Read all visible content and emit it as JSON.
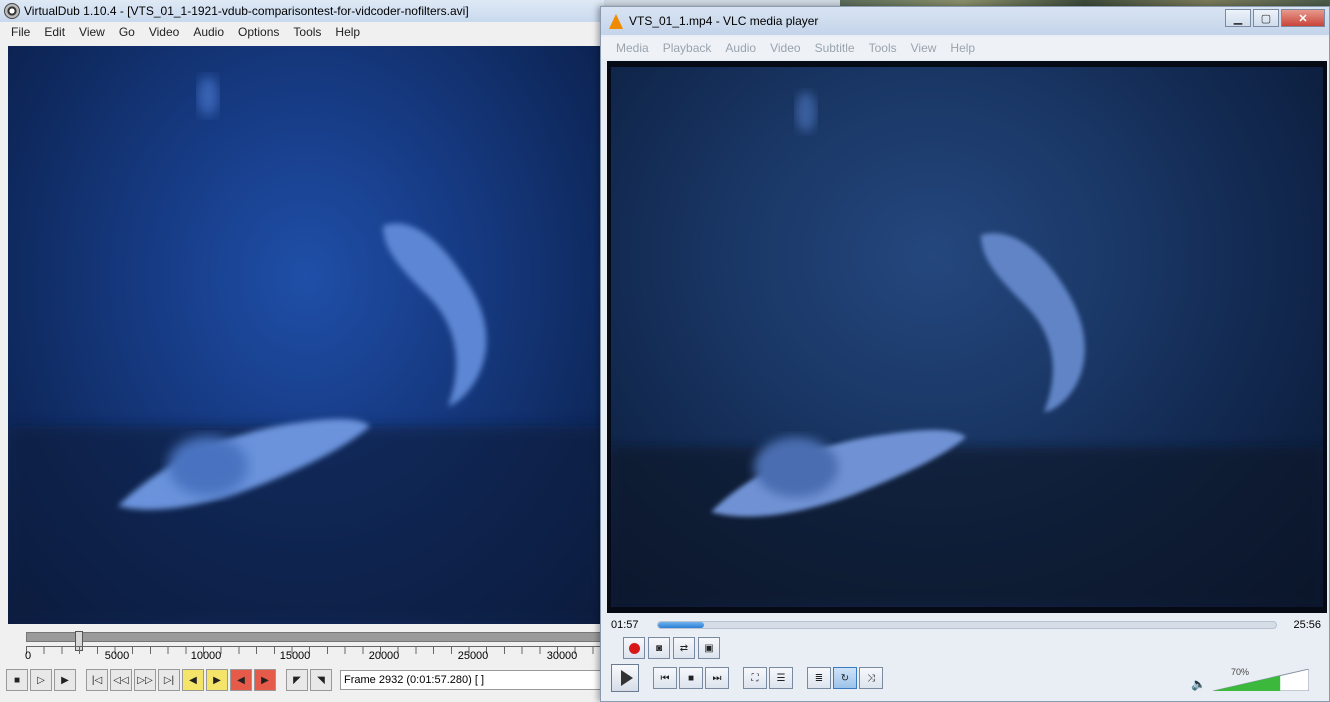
{
  "virtualdub": {
    "title": "VirtualDub 1.10.4 - [VTS_01_1-1921-vdub-comparisontest-for-vidcoder-nofilters.avi]",
    "menu": [
      "File",
      "Edit",
      "View",
      "Go",
      "Video",
      "Audio",
      "Options",
      "Tools",
      "Help"
    ],
    "timeline": {
      "ticks": [
        "0",
        "5000",
        "10000",
        "15000",
        "20000",
        "25000",
        "30000"
      ],
      "position_fraction": 0.089
    },
    "frame_status": "Frame 2932 (0:01:57.280) [ ]"
  },
  "vlc": {
    "title": "VTS_01_1.mp4 - VLC media player",
    "menu": [
      "Media",
      "Playback",
      "Audio",
      "Video",
      "Subtitle",
      "Tools",
      "View",
      "Help"
    ],
    "elapsed": "01:57",
    "duration": "25:56",
    "progress_fraction": 0.075,
    "volume_label": "70%",
    "volume_fraction": 0.7,
    "accent_color": "#2a7fd4"
  }
}
